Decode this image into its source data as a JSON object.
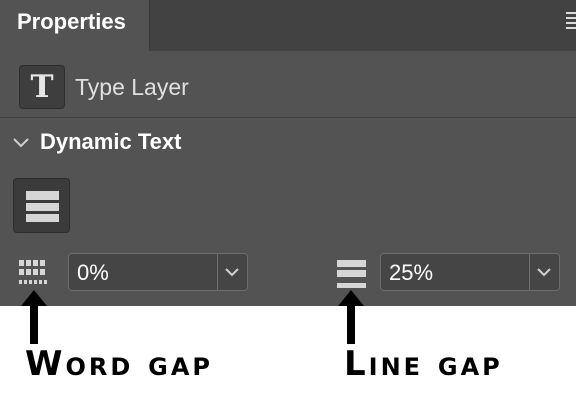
{
  "panel": {
    "tab_label": "Properties",
    "menu_icon": "panel-menu-icon"
  },
  "layer": {
    "icon_glyph": "T",
    "label": "Type Layer"
  },
  "section": {
    "title": "Dynamic Text",
    "chevron_icon": "chevron-down-icon"
  },
  "controls": {
    "word_gap": {
      "value": "0%",
      "icon": "word-gap-icon"
    },
    "line_gap": {
      "value": "25%",
      "icon": "line-gap-icon"
    }
  },
  "annotations": {
    "word_gap_caption": "Word gap",
    "line_gap_caption": "Line gap"
  },
  "colors": {
    "panel_bg": "#535353",
    "tabbar_bg": "#424242",
    "field_bg": "#454545",
    "caption": "#000000"
  }
}
